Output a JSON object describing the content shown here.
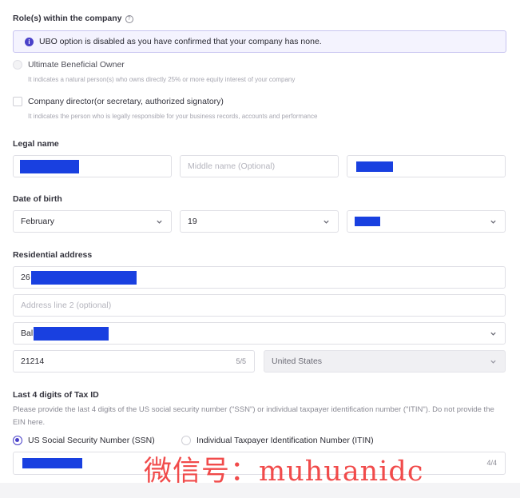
{
  "roles": {
    "label": "Role(s) within the company",
    "help_icon": "question-circle-icon",
    "banner": {
      "icon": "info-icon",
      "text": "UBO option is disabled as you have confirmed that your company has none."
    },
    "options": [
      {
        "title": "Ultimate Beneficial Owner",
        "desc": "It indicates a natural person(s) who owns directly 25% or more equity interest of your company",
        "disabled": true
      },
      {
        "title": "Company director(or secretary, authorized signatory)",
        "desc": "It indicates the person who is legally responsible for your business records, accounts and performance",
        "disabled": false
      }
    ]
  },
  "legal_name": {
    "label": "Legal name",
    "middle_placeholder": "Middle name (Optional)"
  },
  "dob": {
    "label": "Date of birth",
    "month": "February",
    "day": "19"
  },
  "address": {
    "label": "Residential address",
    "line1_prefix": "26",
    "line2_placeholder": "Address line 2 (optional)",
    "city_prefix": "Bal",
    "zip": "21214",
    "zip_counter": "5/5",
    "country": "United States"
  },
  "tax": {
    "label": "Last 4 digits of Tax ID",
    "help": "Please provide the last 4 digits of the US social security number (\"SSN\") or individual taxpayer identification number (\"ITIN\"). Do not provide the EIN here.",
    "options": [
      {
        "label": "US Social Security Number (SSN)",
        "selected": true
      },
      {
        "label": "Individual Taxpayer Identification Number (ITIN)",
        "selected": false
      }
    ],
    "counter": "4/4"
  },
  "watermark": "微信号：muhuanidc",
  "colors": {
    "accent": "#4a41c9",
    "redaction": "#1940e0",
    "watermark": "#f03c3c"
  }
}
